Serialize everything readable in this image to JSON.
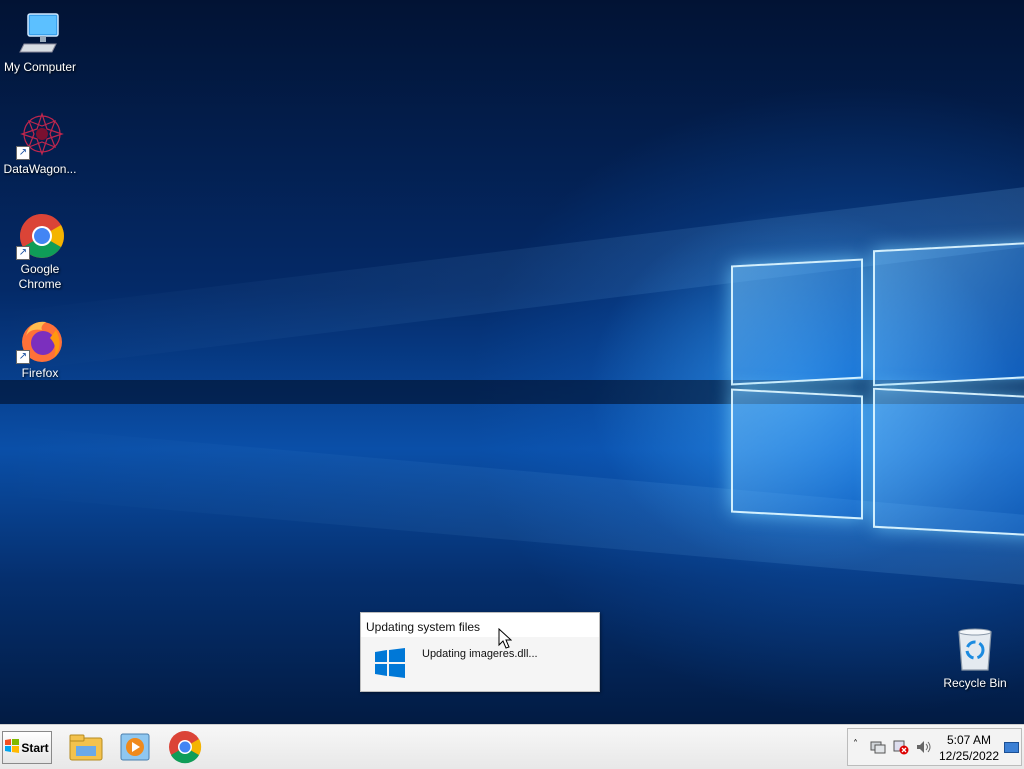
{
  "desktop": {
    "icons": [
      {
        "label": "My Computer"
      },
      {
        "label": "DataWagon..."
      },
      {
        "label": "Google Chrome"
      },
      {
        "label": "Firefox"
      },
      {
        "label": "Recycle Bin"
      }
    ]
  },
  "popup": {
    "title": "Updating system files",
    "message": "Updating imageres.dll..."
  },
  "taskbar": {
    "start_label": "Start",
    "apps": [
      {
        "icon": "file-explorer-icon"
      },
      {
        "icon": "media-player-icon"
      },
      {
        "icon": "chrome-icon"
      }
    ],
    "tray": {
      "time": "5:07 AM",
      "date": "12/25/2022",
      "icons": [
        "chevron-up-icon",
        "network-icon",
        "security-alert-icon",
        "volume-icon",
        "show-desktop-icon"
      ]
    }
  },
  "colors": {
    "wallpaper_dark": "#021334",
    "wallpaper_light": "#0a4fa8",
    "taskbar": "#efefef",
    "popup_bg": "#f5f5f5"
  }
}
